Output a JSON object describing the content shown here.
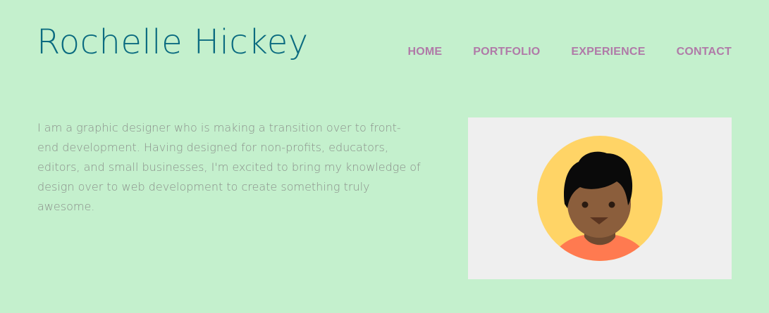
{
  "header": {
    "site_name": "Rochelle Hickey"
  },
  "nav": {
    "items": [
      {
        "label": "HOME"
      },
      {
        "label": "PORTFOLIO"
      },
      {
        "label": "EXPERIENCE"
      },
      {
        "label": "CONTACT"
      }
    ]
  },
  "main": {
    "intro": "I am a graphic designer who is making a transition over to front-end development. Having designed for non-profits, educators, editors, and small businesses, I'm excited to bring my knowledge of design over to web development to create something truly awesome.",
    "portrait_icon": "person-avatar-icon"
  },
  "colors": {
    "background": "#c4f0cd",
    "title": "#0b6b80",
    "nav": "#b07aa8",
    "body_text": "#8a8f8a",
    "image_bg": "#efefef",
    "avatar_circle": "#ffd466",
    "skin": "#8b5e3c",
    "hair": "#0a0a0a",
    "shirt": "#ff7a50"
  }
}
